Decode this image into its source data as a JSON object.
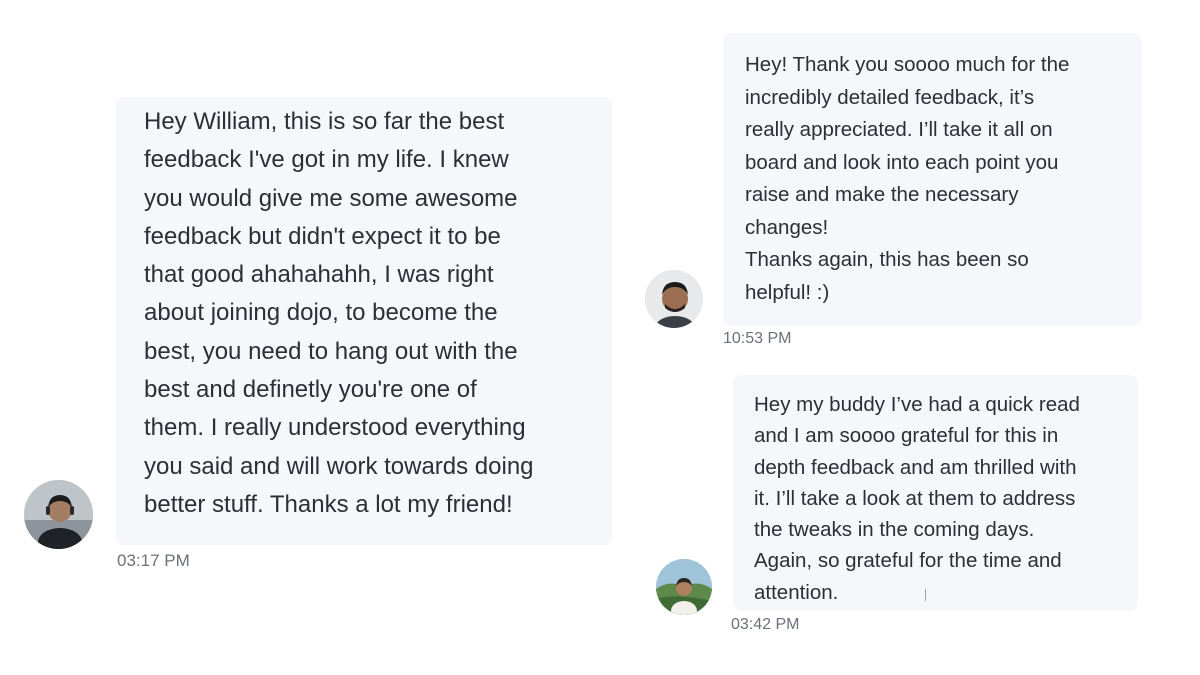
{
  "messages": [
    {
      "text": "Hey William, this is so far the best\nfeedback I've got in my life. I knew\nyou would give me some awesome\nfeedback but didn't expect it to be\nthat good ahahahahh, I was right\nabout joining dojo, to become the\nbest, you need to hang out with the\nbest and definetly you're one of\nthem. I really understood everything\nyou said and will work towards doing\nbetter stuff. Thanks a lot my friend!",
      "time": "03:17 PM"
    },
    {
      "text": "Hey! Thank you soooo much for the\nincredibly detailed feedback, it’s\nreally appreciated. I’ll take it all on\nboard and look into each point you\nraise and make the necessary\nchanges!\nThanks again, this has been so\nhelpful! :)",
      "time": "10:53 PM"
    },
    {
      "text": "Hey my buddy I’ve had a quick read\nand I am soooo grateful for this in\ndepth feedback and am thrilled with\nit. I’ll take a look at them to address\nthe tweaks in the coming days.\nAgain, so grateful for the time and\nattention.",
      "time": "03:42 PM"
    }
  ],
  "colors": {
    "bubble_background": "#f6f7fa",
    "message_text": "#2b2f36",
    "timestamp_text": "#6b7079",
    "page_background": "#ffffff"
  }
}
